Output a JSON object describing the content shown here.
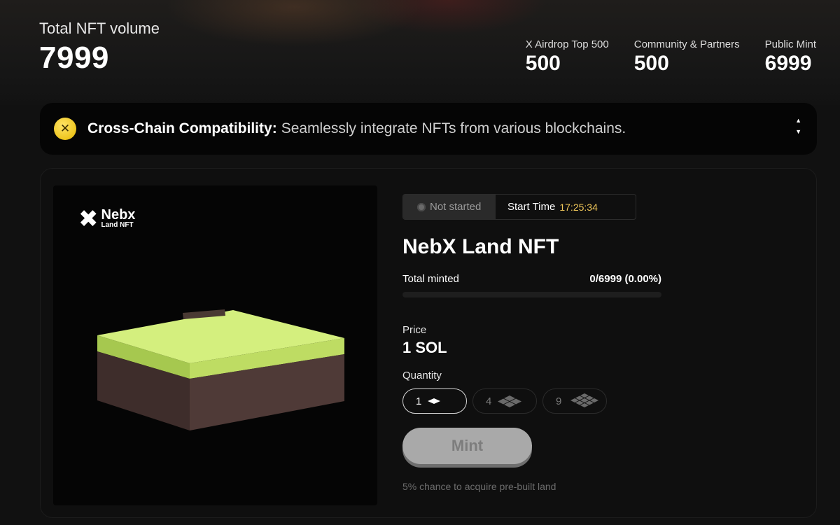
{
  "header": {
    "volume_label": "Total NFT volume",
    "volume_value": "7999",
    "stats": [
      {
        "label": "X Airdrop Top 500",
        "value": "500"
      },
      {
        "label": "Community & Partners",
        "value": "500"
      },
      {
        "label": "Public Mint",
        "value": "6999"
      }
    ]
  },
  "ticker": {
    "icon": "x-coin-icon",
    "title": "Cross-Chain Compatibility:",
    "text": "Seamlessly integrate NFTs from various blockchains.",
    "accent": "#f5d020"
  },
  "nft": {
    "logo_name": "Nebx",
    "logo_sub": "Land NFT",
    "status": "Not started",
    "start_time_label": "Start Time",
    "start_time": "17:25:34",
    "title": "NebX Land NFT",
    "minted_label": "Total minted",
    "minted_value": "0/6999 (0.00%)",
    "minted_fraction": 0,
    "price_label": "Price",
    "price_value": "1 SOL",
    "quantity_label": "Quantity",
    "quantity_options": [
      {
        "value": "1",
        "icon": "single-tile-icon",
        "selected": true
      },
      {
        "value": "4",
        "icon": "four-tile-icon",
        "selected": false
      },
      {
        "value": "9",
        "icon": "nine-tile-icon",
        "selected": false
      }
    ],
    "mint_label": "Mint",
    "note": "5% chance to acquire pre-built land"
  },
  "colors": {
    "time_accent": "#f0c75a",
    "grass": "#d4ef7e",
    "soil": "#4a3633"
  }
}
